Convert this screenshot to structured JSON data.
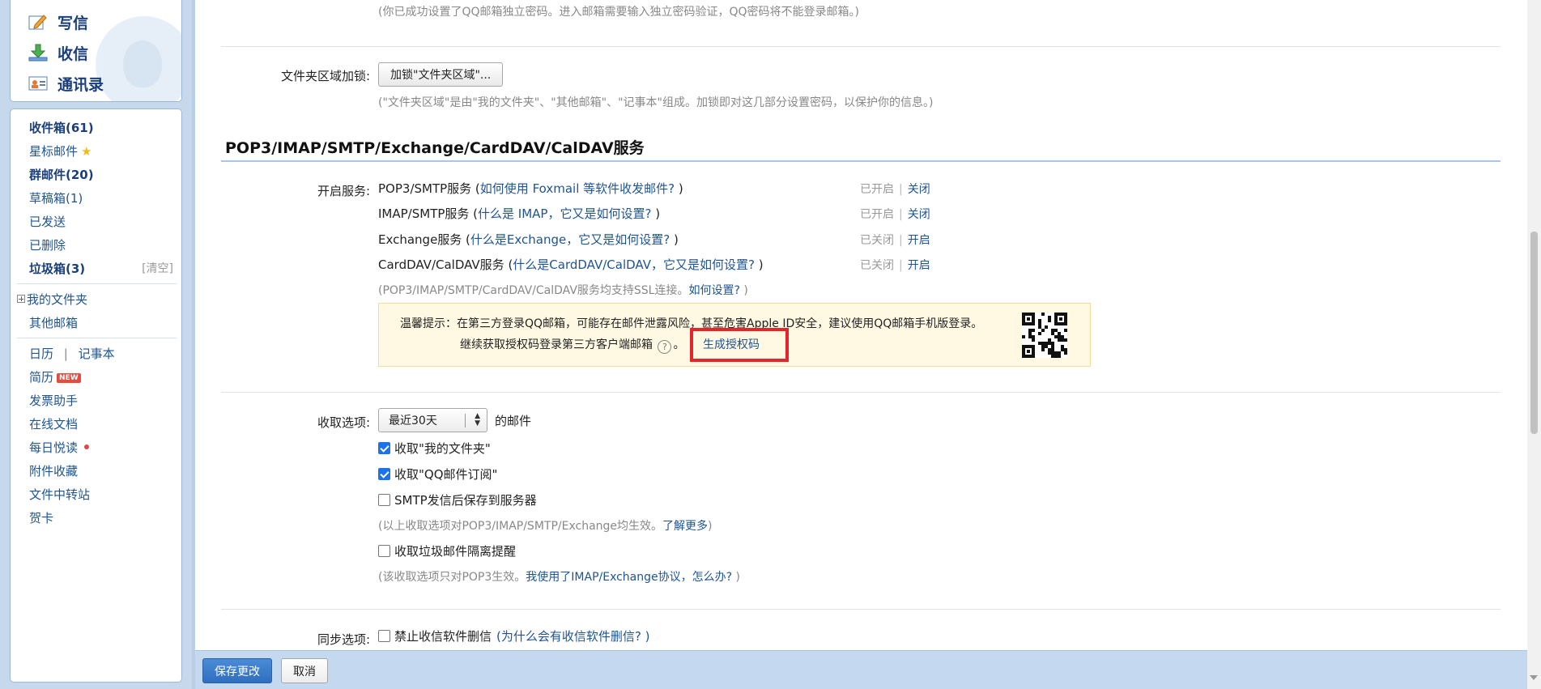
{
  "sidebar": {
    "compose": "写信",
    "inbox": "收信",
    "contacts": "通讯录",
    "folders": {
      "inbox": "收件箱(61)",
      "starred": "星标邮件",
      "group": "群邮件(20)",
      "drafts": "草稿箱(1)",
      "sent": "已发送",
      "deleted": "已删除",
      "spam": "垃圾箱(3)",
      "spam_clear": "[清空]",
      "my_folders": "我的文件夹",
      "other_mailbox": "其他邮箱"
    },
    "apps": {
      "calendar": "日历",
      "sep": "|",
      "notebook": "记事本",
      "resume": "简历",
      "resume_badge": "NEW",
      "invoice": "发票助手",
      "docs": "在线文档",
      "daily": "每日悦读",
      "attachments": "附件收藏",
      "transfer": "文件中转站",
      "cards": "贺卡"
    }
  },
  "content": {
    "top_note": "(你已成功设置了QQ邮箱独立密码。进入邮箱需要输入独立密码验证，QQ密码将不能登录邮箱。)",
    "folder_lock": {
      "label": "文件夹区域加锁:",
      "button": "加锁\"文件夹区域\"...",
      "note": "(\"文件夹区域\"是由\"我的文件夹\"、\"其他邮箱\"、\"记事本\"组成。加锁即对这几部分设置密码，以保护你的信息。)"
    },
    "section_title": "POP3/IMAP/SMTP/Exchange/CardDAV/CalDAV服务",
    "services_label": "开启服务:",
    "services": [
      {
        "name": "POP3/SMTP服务 (",
        "link": "如何使用 Foxmail 等软件收发邮件?",
        "close": " )",
        "status": "已开启",
        "action": "关闭"
      },
      {
        "name": "IMAP/SMTP服务 (",
        "link": "什么是 IMAP，它又是如何设置?",
        "close": " )",
        "status": "已开启",
        "action": "关闭"
      },
      {
        "name": "Exchange服务 (",
        "link": "什么是Exchange，它又是如何设置?",
        "close": " )",
        "status": "已关闭",
        "action": "开启"
      },
      {
        "name": "CardDAV/CalDAV服务 (",
        "link": "什么是CardDAV/CalDAV，它又是如何设置?",
        "close": " )",
        "status": "已关闭",
        "action": "开启"
      }
    ],
    "status_pipe": "|",
    "ssl_note": "(POP3/IMAP/SMTP/CardDAV/CalDAV服务均支持SSL连接。",
    "ssl_link": "如何设置?",
    "ssl_close": " )",
    "tip": {
      "line1": "温馨提示：在第三方登录QQ邮箱，可能存在邮件泄露风险，甚至危害Apple ID安全，建议使用QQ邮箱手机版登录。",
      "line2": "继续获取授权码登录第三方客户端邮箱",
      "help": "?",
      "period": "。",
      "link": "生成授权码"
    },
    "receive": {
      "label": "收取选项:",
      "select_value": "最近30天",
      "suffix": "的邮件",
      "opt1": "收取\"我的文件夹\"",
      "opt2": "收取\"QQ邮件订阅\"",
      "opt3": "SMTP发信后保存到服务器",
      "note1": "(以上收取选项对POP3/IMAP/SMTP/Exchange均生效。",
      "note1_link": "了解更多",
      "note1_close": ")",
      "opt4": "收取垃圾邮件隔离提醒",
      "note2": "(该收取选项只对POP3生效。",
      "note2_link": "我使用了IMAP/Exchange协议，怎么办?",
      "note2_close": " )"
    },
    "sync": {
      "label": "同步选项:",
      "opt1": "禁止收信软件删信",
      "link": "(为什么会有收信软件删信? )"
    }
  },
  "footer": {
    "save": "保存更改",
    "cancel": "取消"
  },
  "colors": {
    "link": "#1e5494",
    "highlight": "#e3262b",
    "primary_button": "#2f6fbe",
    "tip_bg": "#fff9e3"
  }
}
